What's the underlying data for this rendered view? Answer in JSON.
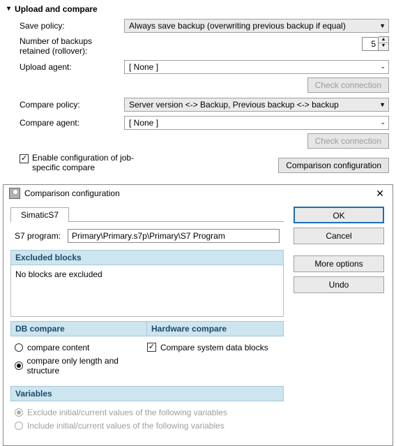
{
  "section": {
    "title": "Upload and compare"
  },
  "labels": {
    "save_policy": "Save policy:",
    "num_backups": "Number of backups retained (rollover):",
    "upload_agent": "Upload agent:",
    "compare_policy": "Compare policy:",
    "compare_agent": "Compare agent:"
  },
  "values": {
    "save_policy": "Always save backup (overwriting previous backup if equal)",
    "num_backups": "5",
    "upload_agent": "[ None ]",
    "compare_policy": "Server version <-> Backup, Previous backup <-> backup",
    "compare_agent": "[ None ]"
  },
  "buttons": {
    "check_connection": "Check connection",
    "comparison_config": "Comparison configuration"
  },
  "enable_config": {
    "label": "Enable configuration of job-specific compare",
    "checked": true
  },
  "dialog": {
    "title": "Comparison configuration",
    "tab": "SimaticS7",
    "s7program_label": "S7 program:",
    "s7program_value": "Primary\\Primary.s7p\\Primary\\S7 Program",
    "excluded_header": "Excluded blocks",
    "excluded_body": "No blocks are excluded",
    "db_compare_header": "DB compare",
    "hw_compare_header": "Hardware compare",
    "db_options": {
      "content": "compare content",
      "length": "compare only length and structure"
    },
    "hw_option": "Compare system data blocks",
    "variables_header": "Variables",
    "var_exclude": "Exclude initial/current values of the following variables",
    "var_include": "Include initial/current values of the following variables",
    "buttons": {
      "ok": "OK",
      "cancel": "Cancel",
      "more": "More options",
      "undo": "Undo"
    }
  }
}
